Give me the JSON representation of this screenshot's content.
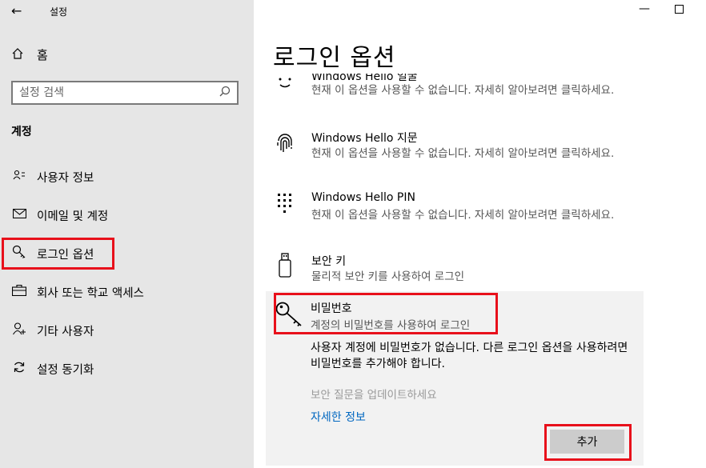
{
  "app": {
    "title": "설정",
    "back_icon": "back-arrow-icon"
  },
  "sidebar": {
    "home_label": "홈",
    "search_placeholder": "설정 검색",
    "section_label": "계정",
    "items": [
      {
        "label": "사용자 정보",
        "icon": "user-info-icon"
      },
      {
        "label": "이메일 및 계정",
        "icon": "mail-icon"
      },
      {
        "label": "로그인 옵션",
        "icon": "key-icon",
        "selected": true
      },
      {
        "label": "회사 또는 학교 액세스",
        "icon": "briefcase-icon"
      },
      {
        "label": "기타 사용자",
        "icon": "person-add-icon"
      },
      {
        "label": "설정 동기화",
        "icon": "sync-icon"
      }
    ]
  },
  "main": {
    "title": "로그인 옵션",
    "options": [
      {
        "title": "Windows Hello 얼굴",
        "desc": "현재 이 옵션을 사용할 수 없습니다. 자세히 알아보려면 클릭하세요.",
        "icon": "face-icon"
      },
      {
        "title": "Windows Hello 지문",
        "desc": "현재 이 옵션을 사용할 수 없습니다. 자세히 알아보려면 클릭하세요.",
        "icon": "fingerprint-icon"
      },
      {
        "title": "Windows Hello PIN",
        "desc": "현재 이 옵션을 사용할 수 없습니다. 자세히 알아보려면 클릭하세요.",
        "icon": "pin-keypad-icon"
      },
      {
        "title": "보안 키",
        "desc": "물리적 보안 키를 사용하여 로그인",
        "icon": "usb-key-icon"
      }
    ],
    "password": {
      "title": "비밀번호",
      "desc": "계정의 비밀번호를 사용하여 로그인",
      "message": "사용자 계정에 비밀번호가 없습니다. 다른 로그인 옵션을 사용하려면 비밀번호를 추가해야 합니다.",
      "security_question": "보안 질문을 업데이트하세요",
      "more_info": "자세한 정보",
      "add_button": "추가"
    }
  },
  "colors": {
    "highlight": "#e8101b",
    "link": "#0067c0",
    "sidebar_bg": "#e6e6e6"
  }
}
